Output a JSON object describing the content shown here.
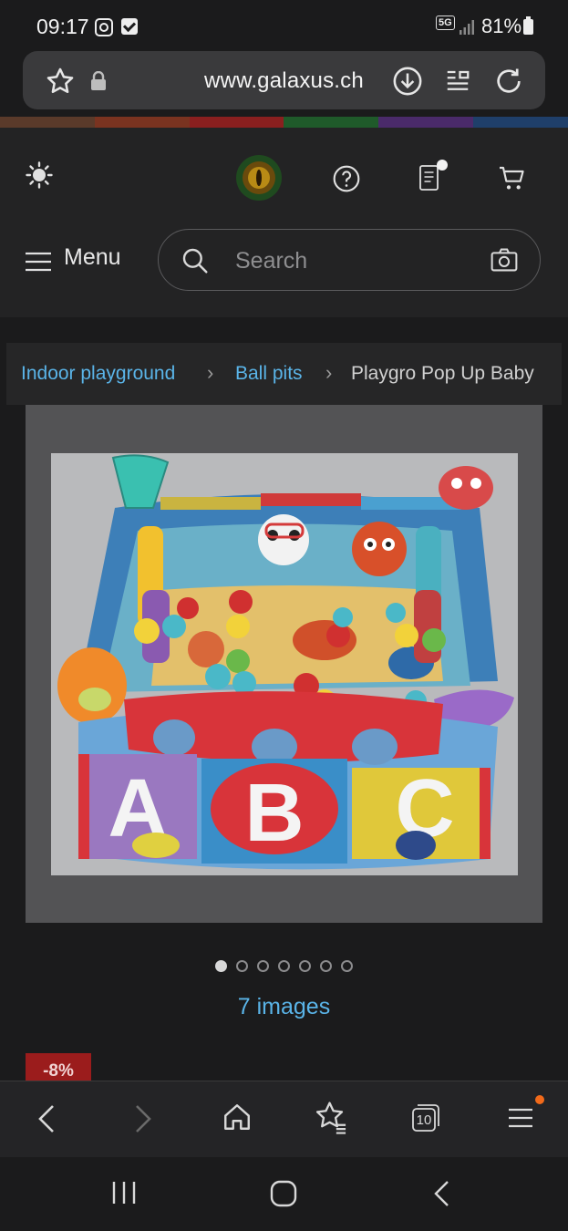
{
  "status": {
    "time": "09:17",
    "network": "5G",
    "battery": "81%"
  },
  "browser": {
    "url": "www.galaxus.ch",
    "icons": [
      "star-icon",
      "lock-icon",
      "download-icon",
      "reader-icon",
      "reload-icon"
    ]
  },
  "strip_colors": [
    "#5a3a2a",
    "#7a3320",
    "#8a1f1f",
    "#1f5a2a",
    "#4a2a6a",
    "#1f3f6a"
  ],
  "header": {
    "menu_label": "Menu",
    "search_placeholder": "Search",
    "icons": [
      "theme-sun-icon",
      "profile-avatar",
      "help-icon",
      "notes-icon",
      "cart-icon",
      "camera-icon",
      "hamburger-icon",
      "search-icon"
    ]
  },
  "breadcrumb": {
    "items": [
      "Indoor playground",
      "Ball pits",
      "Playgro Pop Up Baby"
    ]
  },
  "gallery": {
    "image_count_label": "7 images",
    "total_images": 7,
    "active_index": 0
  },
  "product": {
    "discount_badge": "-8%"
  },
  "product_image": {
    "letters": [
      "A",
      "B",
      "C"
    ]
  },
  "colors": {
    "link": "#5ab4e8",
    "badge": "#9b1c1c",
    "background": "#1b1b1c"
  },
  "bottom_bar": {
    "icons": [
      "back-icon",
      "forward-icon",
      "home-icon",
      "bookmarks-icon",
      "tabs-icon",
      "menu-icon"
    ],
    "tabs_count": "10"
  },
  "system_nav": {
    "icons": [
      "recents-icon",
      "home-circle-icon",
      "system-back-icon"
    ]
  }
}
